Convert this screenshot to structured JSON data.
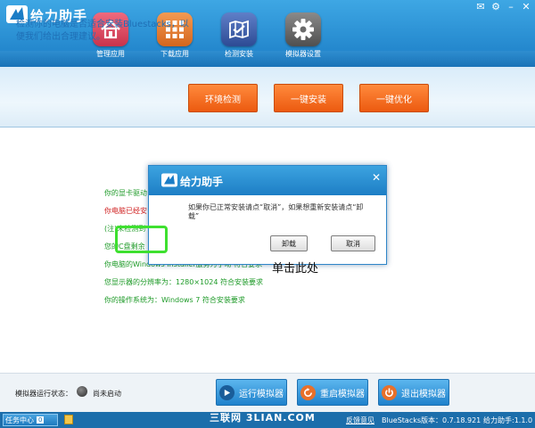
{
  "app": {
    "title": "给力助手"
  },
  "nav": [
    {
      "label": "管理应用",
      "icon": "home-icon",
      "color": "#d8455b"
    },
    {
      "label": "下载应用",
      "icon": "grid-icon",
      "color": "#e07a2f"
    },
    {
      "label": "检测安装",
      "icon": "map-check-icon",
      "color": "#3a5ba8"
    },
    {
      "label": "模拟器设置",
      "icon": "gear-icon",
      "color": "#6a6a6a"
    }
  ],
  "info": {
    "text": "检测你的电脑是否适合安装Bluestacks，以便我们给出合理建议。",
    "env_check": "环境检测",
    "one_install": "一键安装",
    "one_optimize": "一键优化"
  },
  "results": [
    "你的显卡驱动",
    "你电脑已经安",
    "(注)未检测到",
    "您的C盘剩余",
    "你电脑的Windows Installer服务为手动 符合要求",
    "您显示器的分辨率为：1280×1024 符合安装要求",
    "你的操作系统为：Windows 7 符合安装要求"
  ],
  "dialog": {
    "title": "给力助手",
    "message": "如果你已正常安装请点“取消”，如果想重新安装请点“卸载”",
    "uninstall": "卸载",
    "cancel": "取消",
    "annotation": "单击此处"
  },
  "status": {
    "label": "模拟器运行状态：",
    "value": "尚未启动"
  },
  "actions": {
    "run": "运行模拟器",
    "restart": "重启模拟器",
    "exit": "退出模拟器"
  },
  "taskbar": {
    "task_center": "任务中心",
    "task_count": "0",
    "watermark": "三联网 3LIAN.COM",
    "feedback": "反馈意见",
    "bs_version": "BlueStacks版本：0.7.18.921",
    "app_version": "给力助手:1.1.0"
  },
  "colors": {
    "accent": "#1b7dc6",
    "orange": "#ec5a10",
    "green_text": "#1d9a27",
    "red_text": "#d02222",
    "highlight": "#3ee02f"
  }
}
